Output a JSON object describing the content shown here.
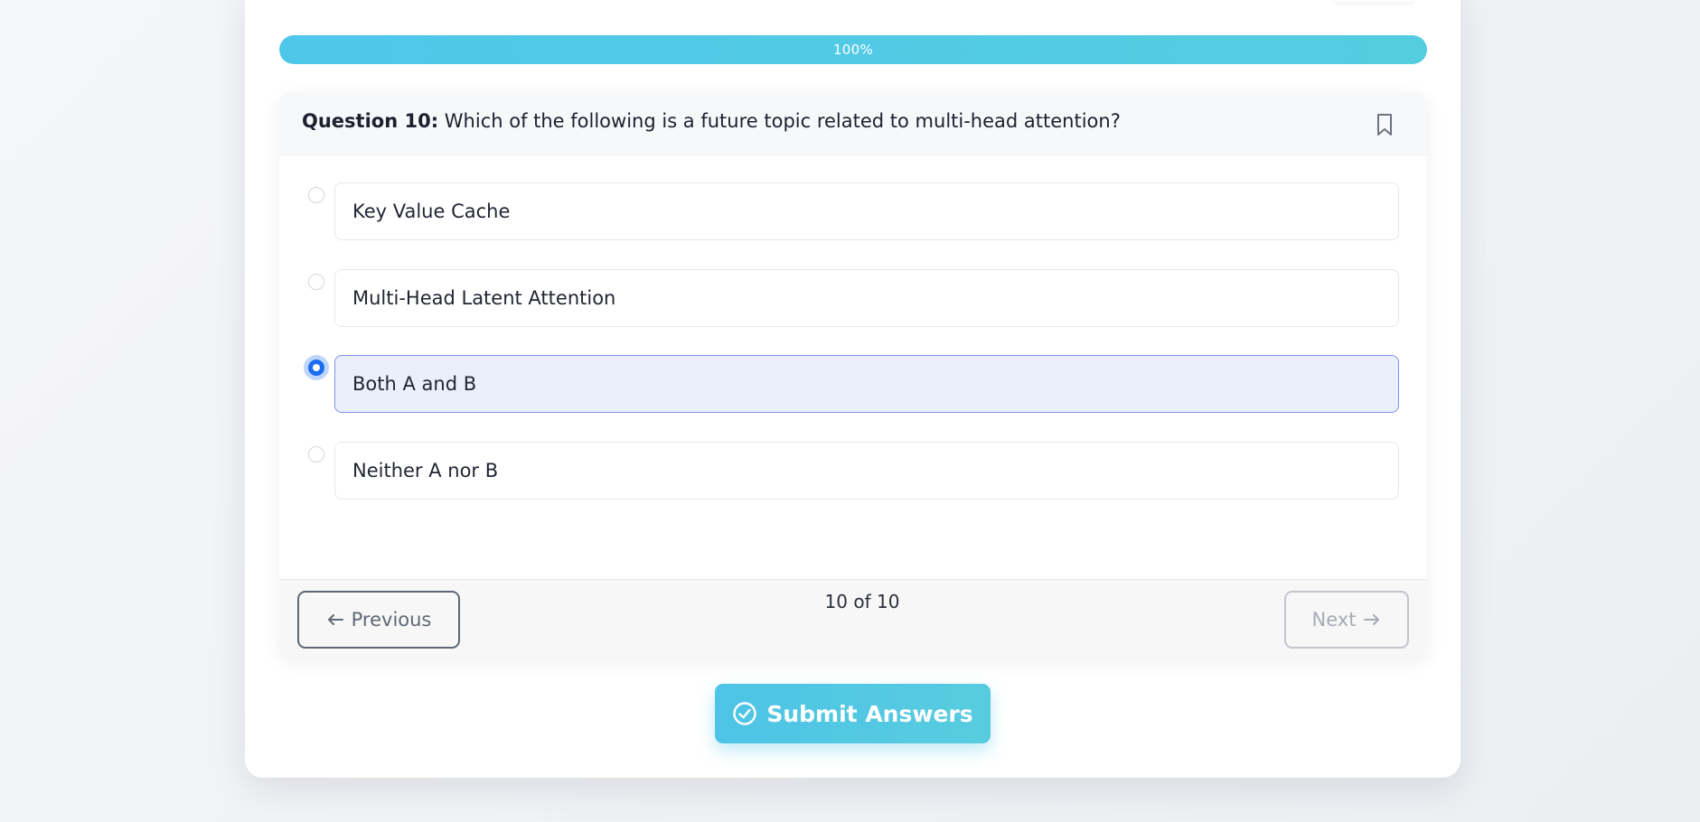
{
  "progress": {
    "percent": 100,
    "label": "100%",
    "color": "#4ec7ea"
  },
  "question": {
    "number_label": "Question 10:",
    "text": "Which of the following is a future topic related to multi-head attention?",
    "bookmark_icon": "bookmark-icon",
    "options": [
      {
        "label": "Key Value Cache",
        "selected": false
      },
      {
        "label": "Multi-Head Latent Attention",
        "selected": false
      },
      {
        "label": "Both A and B",
        "selected": true
      },
      {
        "label": "Neither A nor B",
        "selected": false
      }
    ]
  },
  "navigation": {
    "previous_label": "Previous",
    "previous_icon": "arrow-left-icon",
    "counter": "10 of 10",
    "next_label": "Next",
    "next_icon": "arrow-right-icon",
    "next_disabled": true
  },
  "submit": {
    "label": "Submit Answers",
    "icon": "check-circle-icon",
    "color": "#4ec4e6"
  },
  "colors": {
    "selected_radio": "#1a6cf0",
    "selected_option_bg": "#ebeffc",
    "selected_option_border": "#7f92e8"
  }
}
